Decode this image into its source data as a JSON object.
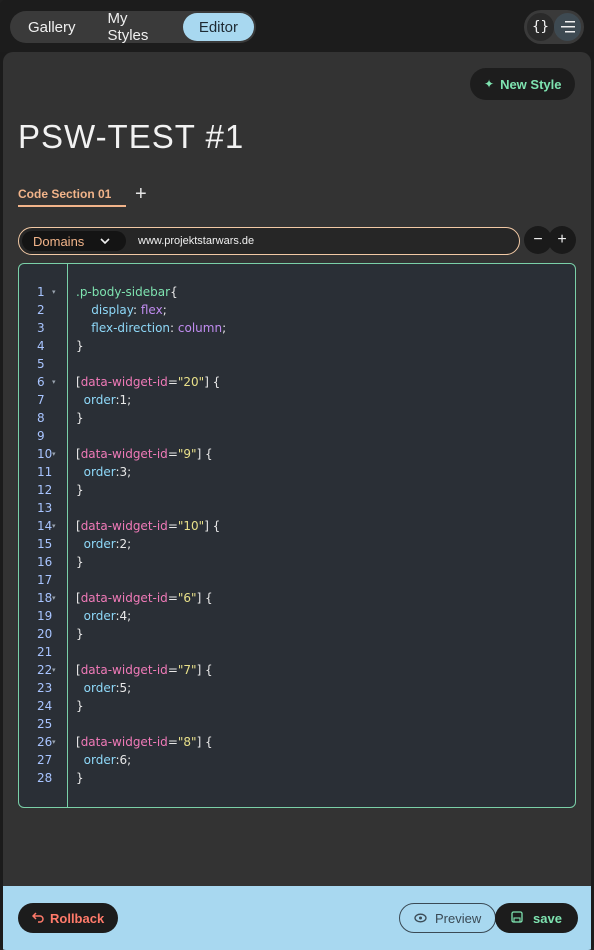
{
  "nav": {
    "tabs": [
      {
        "label": "Gallery",
        "active": false
      },
      {
        "label": "My Styles",
        "active": false
      },
      {
        "label": "Editor",
        "active": true
      }
    ],
    "icons": [
      "braces-icon",
      "menu-lines-icon"
    ],
    "braces_glyph": "{}"
  },
  "toolbar": {
    "new_style_label": "New Style"
  },
  "page": {
    "title": "PSW-TEST #1"
  },
  "sections": {
    "active_label": "Code Section 01",
    "add_label": "+"
  },
  "domain": {
    "select_label": "Domains",
    "value": "www.projektstarwars.de",
    "minus_label": "−",
    "plus_label": "+"
  },
  "code": {
    "lines": [
      {
        "n": "1",
        "fold": true,
        "tokens": [
          [
            "sel",
            ".p-body-sidebar"
          ],
          [
            "brace",
            "{"
          ]
        ]
      },
      {
        "n": "2",
        "fold": false,
        "tokens": [
          [
            "brace",
            "    "
          ],
          [
            "prop",
            "display"
          ],
          [
            "brace",
            ": "
          ],
          [
            "val",
            "flex"
          ],
          [
            "brace",
            ";"
          ]
        ]
      },
      {
        "n": "3",
        "fold": false,
        "tokens": [
          [
            "brace",
            "    "
          ],
          [
            "prop",
            "flex-direction"
          ],
          [
            "brace",
            ": "
          ],
          [
            "val",
            "column"
          ],
          [
            "brace",
            ";"
          ]
        ]
      },
      {
        "n": "4",
        "fold": false,
        "tokens": [
          [
            "brace",
            "}"
          ]
        ]
      },
      {
        "n": "5",
        "fold": false,
        "tokens": []
      },
      {
        "n": "6",
        "fold": true,
        "tokens": [
          [
            "brace",
            "["
          ],
          [
            "attr",
            "data-widget-id"
          ],
          [
            "brace",
            "="
          ],
          [
            "str",
            "\"20\""
          ],
          [
            "brace",
            "] {"
          ]
        ]
      },
      {
        "n": "7",
        "fold": false,
        "tokens": [
          [
            "brace",
            "  "
          ],
          [
            "prop",
            "order"
          ],
          [
            "brace",
            ":1;"
          ]
        ]
      },
      {
        "n": "8",
        "fold": false,
        "tokens": [
          [
            "brace",
            "}"
          ]
        ]
      },
      {
        "n": "9",
        "fold": false,
        "tokens": []
      },
      {
        "n": "10",
        "fold": true,
        "tokens": [
          [
            "brace",
            "["
          ],
          [
            "attr",
            "data-widget-id"
          ],
          [
            "brace",
            "="
          ],
          [
            "str",
            "\"9\""
          ],
          [
            "brace",
            "] {"
          ]
        ]
      },
      {
        "n": "11",
        "fold": false,
        "tokens": [
          [
            "brace",
            "  "
          ],
          [
            "prop",
            "order"
          ],
          [
            "brace",
            ":3;"
          ]
        ]
      },
      {
        "n": "12",
        "fold": false,
        "tokens": [
          [
            "brace",
            "}"
          ]
        ]
      },
      {
        "n": "13",
        "fold": false,
        "tokens": []
      },
      {
        "n": "14",
        "fold": true,
        "tokens": [
          [
            "brace",
            "["
          ],
          [
            "attr",
            "data-widget-id"
          ],
          [
            "brace",
            "="
          ],
          [
            "str",
            "\"10\""
          ],
          [
            "brace",
            "] {"
          ]
        ]
      },
      {
        "n": "15",
        "fold": false,
        "tokens": [
          [
            "brace",
            "  "
          ],
          [
            "prop",
            "order"
          ],
          [
            "brace",
            ":2;"
          ]
        ]
      },
      {
        "n": "16",
        "fold": false,
        "tokens": [
          [
            "brace",
            "}"
          ]
        ]
      },
      {
        "n": "17",
        "fold": false,
        "tokens": []
      },
      {
        "n": "18",
        "fold": true,
        "tokens": [
          [
            "brace",
            "["
          ],
          [
            "attr",
            "data-widget-id"
          ],
          [
            "brace",
            "="
          ],
          [
            "str",
            "\"6\""
          ],
          [
            "brace",
            "] {"
          ]
        ]
      },
      {
        "n": "19",
        "fold": false,
        "tokens": [
          [
            "brace",
            "  "
          ],
          [
            "prop",
            "order"
          ],
          [
            "brace",
            ":4;"
          ]
        ]
      },
      {
        "n": "20",
        "fold": false,
        "tokens": [
          [
            "brace",
            "}"
          ]
        ]
      },
      {
        "n": "21",
        "fold": false,
        "tokens": []
      },
      {
        "n": "22",
        "fold": true,
        "tokens": [
          [
            "brace",
            "["
          ],
          [
            "attr",
            "data-widget-id"
          ],
          [
            "brace",
            "="
          ],
          [
            "str",
            "\"7\""
          ],
          [
            "brace",
            "] {"
          ]
        ]
      },
      {
        "n": "23",
        "fold": false,
        "tokens": [
          [
            "brace",
            "  "
          ],
          [
            "prop",
            "order"
          ],
          [
            "brace",
            ":5;"
          ]
        ]
      },
      {
        "n": "24",
        "fold": false,
        "tokens": [
          [
            "brace",
            "}"
          ]
        ]
      },
      {
        "n": "25",
        "fold": false,
        "tokens": []
      },
      {
        "n": "26",
        "fold": true,
        "tokens": [
          [
            "brace",
            "["
          ],
          [
            "attr",
            "data-widget-id"
          ],
          [
            "brace",
            "="
          ],
          [
            "str",
            "\"8\""
          ],
          [
            "brace",
            "] {"
          ]
        ]
      },
      {
        "n": "27",
        "fold": false,
        "tokens": [
          [
            "brace",
            "  "
          ],
          [
            "prop",
            "order"
          ],
          [
            "brace",
            ":6;"
          ]
        ]
      },
      {
        "n": "28",
        "fold": false,
        "tokens": [
          [
            "brace",
            "}"
          ]
        ]
      }
    ]
  },
  "footer": {
    "rollback_label": "Rollback",
    "preview_label": "Preview",
    "save_label": "save"
  },
  "colors": {
    "accent_blue": "#a8d8f0",
    "accent_green": "#7ee3b0",
    "accent_orange": "#f2b48a",
    "danger": "#ff7a6a"
  }
}
